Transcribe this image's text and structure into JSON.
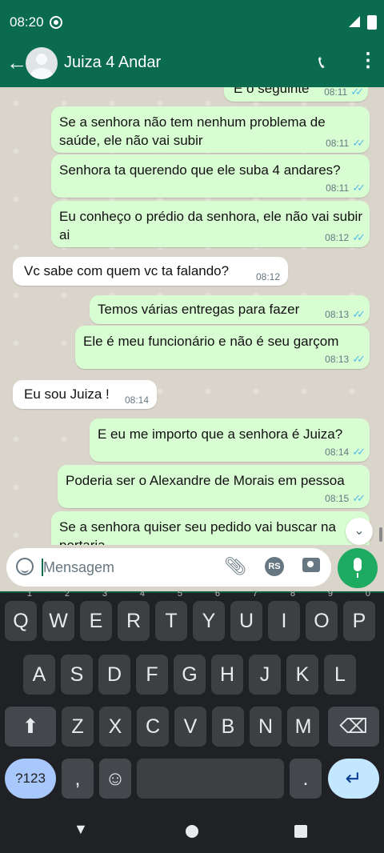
{
  "status_bar": {
    "time": "08:20"
  },
  "header": {
    "back_icon": "arrow-left-icon",
    "contact_name": "Juiza 4 Andar"
  },
  "messages": [
    {
      "dir": "out",
      "text": "E o seguinte",
      "time": "08:11"
    },
    {
      "dir": "out",
      "text": "Se a senhora não tem nenhum problema de saúde, ele não vai subir",
      "time": "08:11"
    },
    {
      "dir": "out",
      "text": "Senhora ta querendo que ele suba 4 andares?",
      "time": "08:11"
    },
    {
      "dir": "out",
      "text": "Eu conheço o prédio da senhora, ele não vai subir ai",
      "time": "08:12"
    },
    {
      "dir": "in",
      "text": "Vc sabe com quem vc ta falando?",
      "time": "08:12"
    },
    {
      "dir": "out",
      "text": "Temos várias entregas para fazer",
      "time": "08:13"
    },
    {
      "dir": "out",
      "text": "Ele é meu funcionário e não é seu  garçom",
      "time": "08:13"
    },
    {
      "dir": "in",
      "text": "Eu sou Juiza !",
      "time": "08:14"
    },
    {
      "dir": "out",
      "text": "E eu me importo que a senhora é Juiza?",
      "time": "08:14"
    },
    {
      "dir": "out",
      "text": "Poderia ser o Alexandre de Morais em pessoa",
      "time": "08:15"
    },
    {
      "dir": "out",
      "text": "Se a senhora quiser seu pedido vai buscar na portaria",
      "time": ""
    }
  ],
  "composer": {
    "placeholder": "Mensagem",
    "rs_badge": "RS"
  },
  "keyboard": {
    "row1": [
      "Q",
      "W",
      "E",
      "R",
      "T",
      "Y",
      "U",
      "I",
      "O",
      "P"
    ],
    "row1_nums": [
      "1",
      "2",
      "3",
      "4",
      "5",
      "6",
      "7",
      "8",
      "9",
      "0"
    ],
    "row2": [
      "A",
      "S",
      "D",
      "F",
      "G",
      "H",
      "J",
      "K",
      "L"
    ],
    "row3": [
      "Z",
      "X",
      "C",
      "V",
      "B",
      "N",
      "M"
    ],
    "sym_label": "?123",
    "comma": ",",
    "period": "."
  }
}
